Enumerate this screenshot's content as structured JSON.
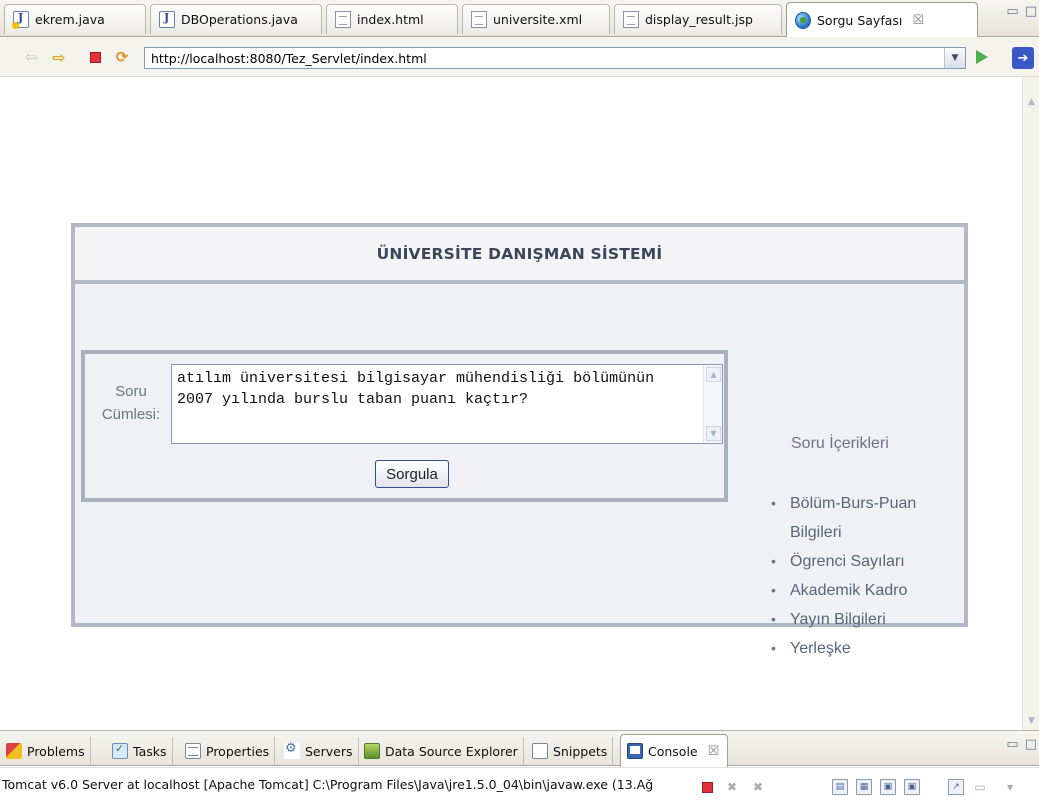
{
  "editor_tabs": [
    {
      "label": "ekrem.java",
      "icon": "java-file-icon"
    },
    {
      "label": "DBOperations.java",
      "icon": "java-file-icon"
    },
    {
      "label": "index.html",
      "icon": "html-file-icon"
    },
    {
      "label": "universite.xml",
      "icon": "xml-file-icon"
    },
    {
      "label": "display_result.jsp",
      "icon": "jsp-file-icon"
    },
    {
      "label": "Sorgu Sayfası",
      "icon": "globe-icon",
      "close": "☒"
    }
  ],
  "browser": {
    "url": "http://localhost:8080/Tez_Servlet/index.html"
  },
  "page": {
    "title": "ÜNİVERSİTE DANIŞMAN SİSTEMİ",
    "question_label_line1": "Soru",
    "question_label_line2": "Cümlesi:",
    "question_text": "atılım üniversitesi bilgisayar mühendisliği bölümünün 2007 yılında burslu taban puanı kaçtır?",
    "submit_label": "Sorgula",
    "side_title": "Soru İçerikleri",
    "side_items": [
      "Bölüm-Burs-Puan Bilgileri",
      "Ögrenci Sayıları",
      "Akademik Kadro",
      "Yayın Bilgileri",
      "Yerleşke"
    ]
  },
  "view_tabs": [
    {
      "label": "Problems"
    },
    {
      "label": "Tasks"
    },
    {
      "label": "Properties"
    },
    {
      "label": "Servers"
    },
    {
      "label": "Data Source Explorer"
    },
    {
      "label": "Snippets"
    },
    {
      "label": "Console",
      "close": "☒"
    }
  ],
  "console": {
    "status": "Tomcat v6.0 Server at localhost [Apache Tomcat] C:\\Program Files\\Java\\jre1.5.0_04\\bin\\javaw.exe (13.Ağ"
  },
  "colors": {
    "panel_border": "#b2b8c6",
    "panel_bg": "#f0f1f4",
    "title_text": "#3c4658",
    "stop_red": "#e0303a"
  }
}
